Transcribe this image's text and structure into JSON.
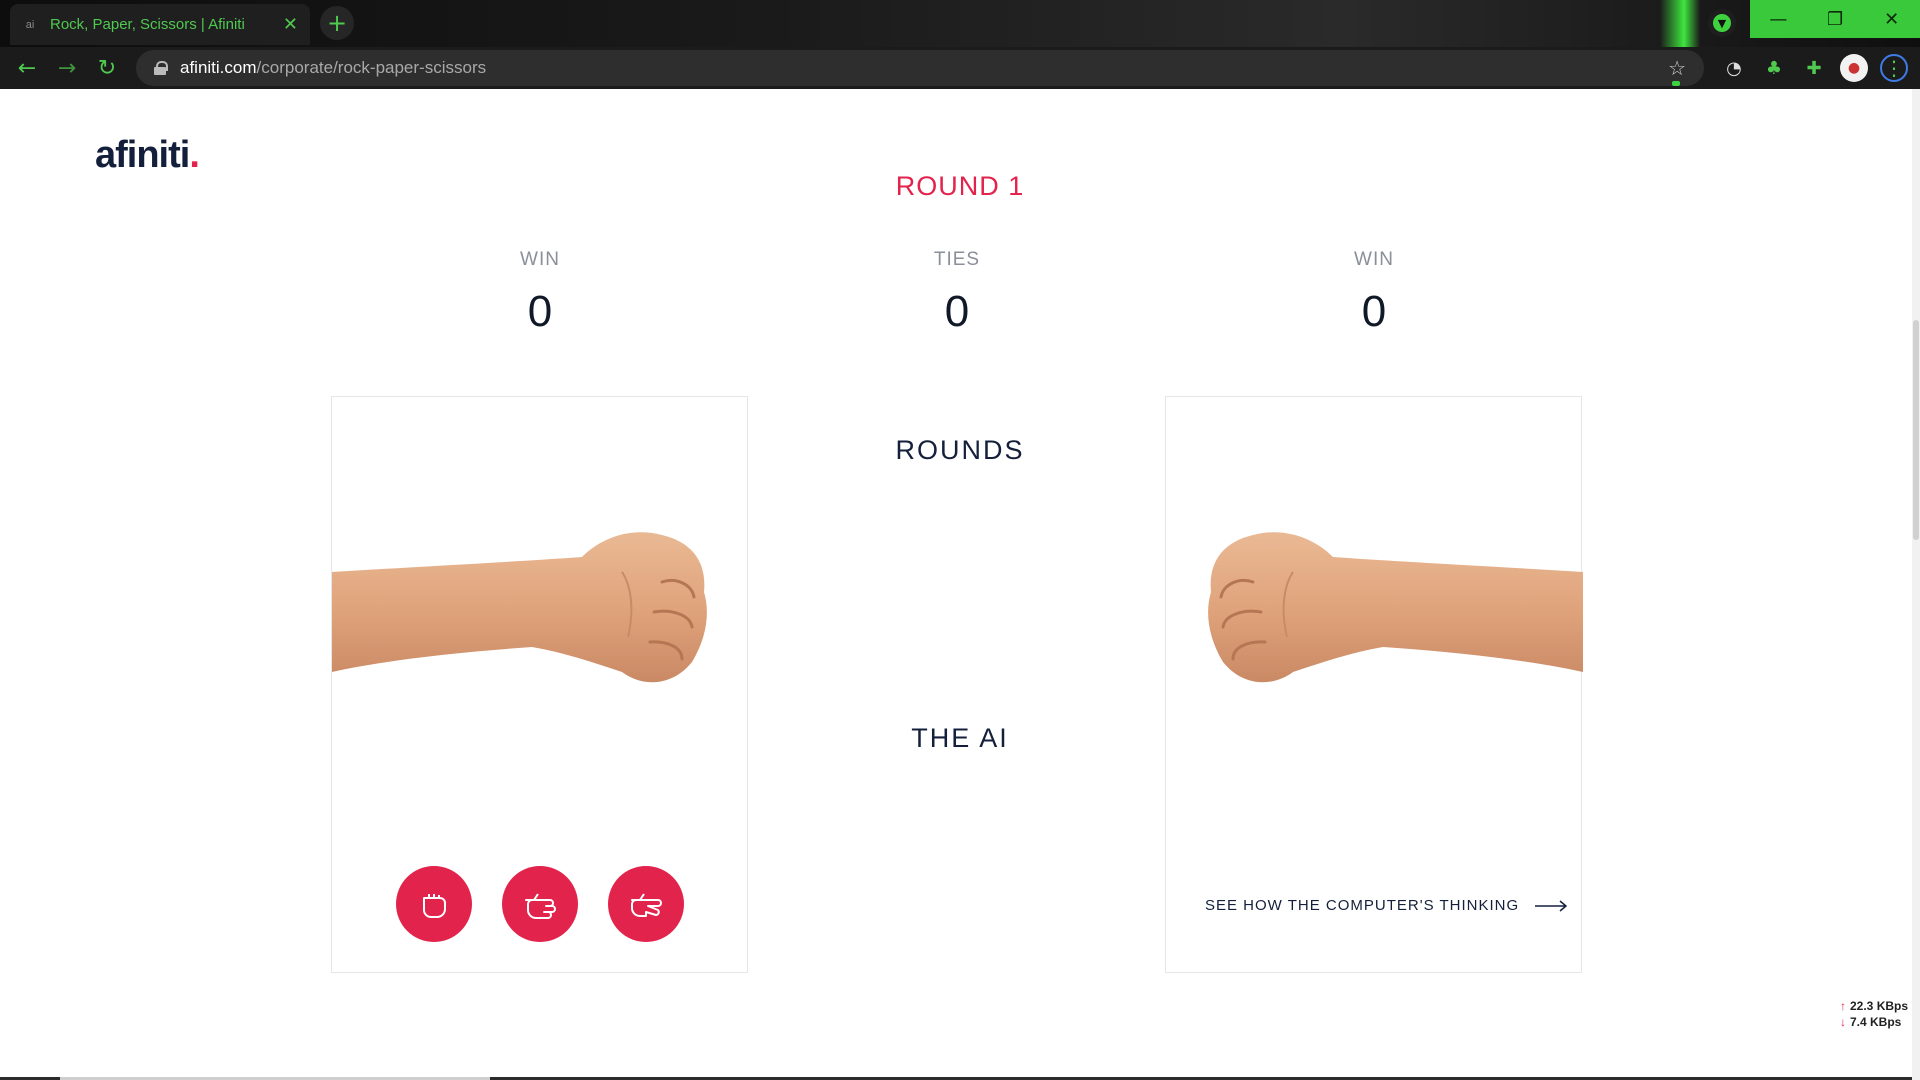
{
  "browser": {
    "tab_title": "Rock, Paper, Scissors | Afiniti",
    "tab_favicon": "ai",
    "url_host": "afiniti.com",
    "url_path": "/corporate/rock-paper-scissors",
    "accent_color": "#3fd23f"
  },
  "page": {
    "logo_text": "afiniti",
    "logo_dot": ".",
    "round_title": "ROUND 1",
    "scores": [
      {
        "label": "WIN",
        "value": "0"
      },
      {
        "label": "TIES",
        "value": "0"
      },
      {
        "label": "WIN",
        "value": "0"
      }
    ],
    "center_top_label": "ROUNDS",
    "center_bottom_label": "THE AI",
    "choices": [
      "rock-icon",
      "paper-icon",
      "scissors-icon"
    ],
    "think_link": "SEE HOW THE COMPUTER'S THINKING",
    "brand_color": "#e2234b"
  },
  "network_meter": {
    "upload": "22.3 KBps",
    "download": "7.4 KBps"
  }
}
